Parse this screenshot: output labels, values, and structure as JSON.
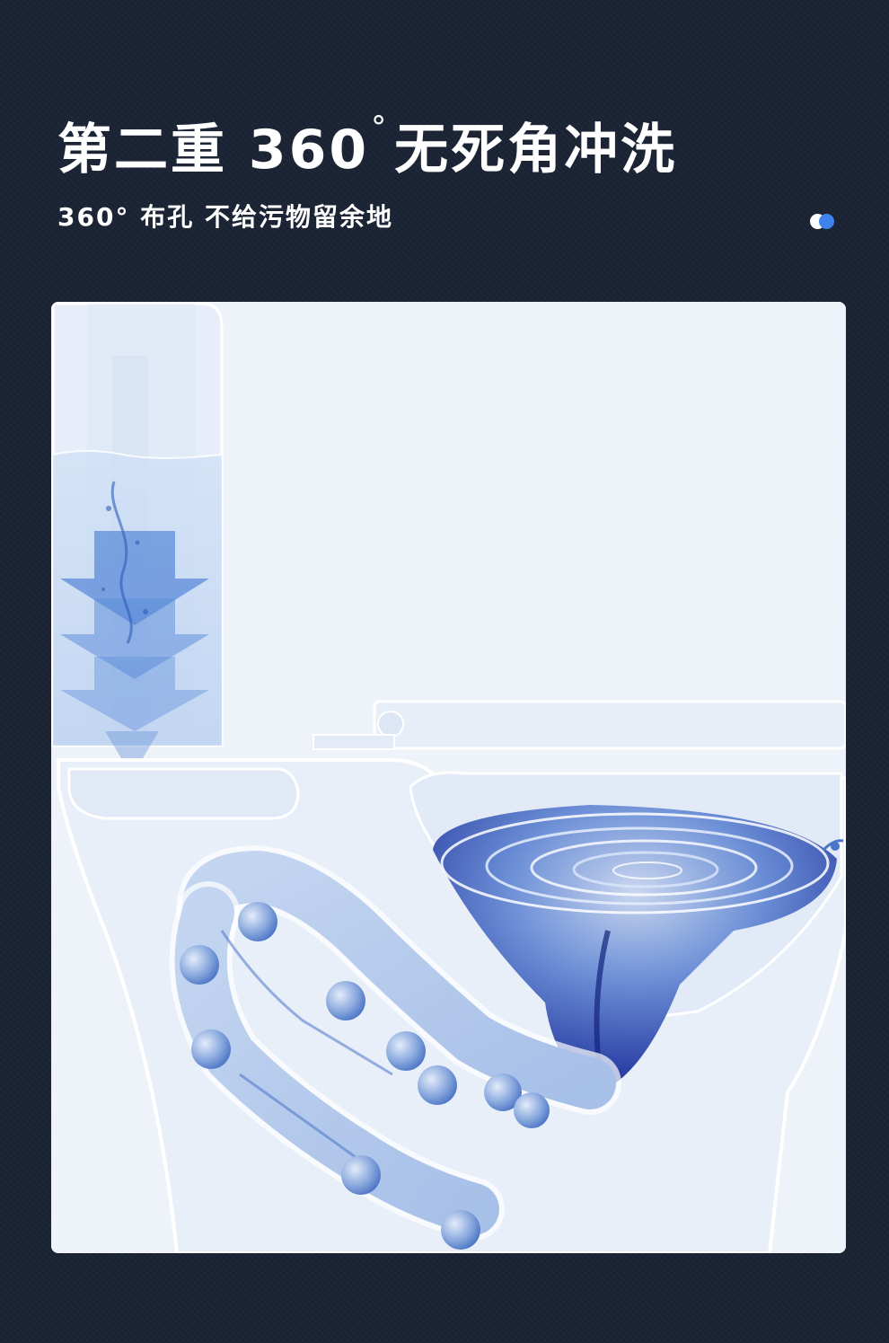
{
  "header": {
    "title_prefix": "第二重 360",
    "title_degree": "°",
    "title_suffix": "无死角冲洗",
    "subtitle": "360° 布孔 不给污物留余地"
  },
  "indicator": {
    "colors": [
      "#ffffff",
      "#3f82ec"
    ]
  },
  "illustration": {
    "subject": "toilet-cross-section-flush-diagram",
    "palette": {
      "background": "#eef2f9",
      "water": "#3a6fd4",
      "deep_water": "#1e2f9a",
      "outline": "#ffffff"
    }
  }
}
